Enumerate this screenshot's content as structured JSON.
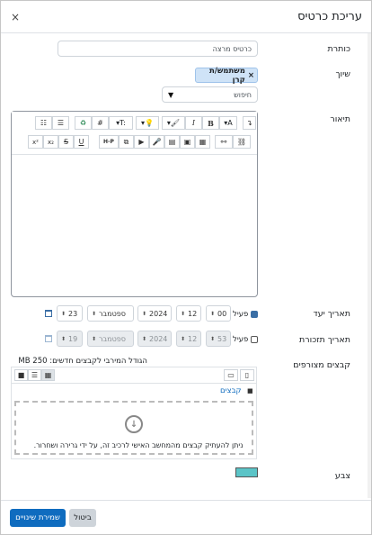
{
  "modal": {
    "title": "עריכת כרטיס",
    "close_glyph": "×"
  },
  "fields": {
    "title": {
      "label": "כותרת",
      "value": "כרטיס מרצה"
    },
    "assign": {
      "label": "שיוך",
      "pill": "משתמש/ת קרן",
      "pill_remove": "×",
      "search_placeholder": "חיפוש",
      "dropdown_arrow": "▼"
    },
    "description": {
      "label": "תיאור"
    },
    "due": {
      "label": "תאריך יעד",
      "enable_label": "פעיל",
      "day": "23",
      "month": "ספטמבר",
      "year": "2024",
      "hour": "12",
      "minute": "00"
    },
    "reminder": {
      "label": "תאריך תזכורת",
      "enable_label": "פעיל",
      "day": "19",
      "month": "ספטמבר",
      "year": "2024",
      "hour": "12",
      "minute": "53"
    },
    "files": {
      "label": "קבצים מצורפים",
      "max_size": "הגודל המירבי לקבצים חדשים: 250 MB",
      "folder_label": "קבצים",
      "drop_text": "ניתן להעתיק קבצים מהמחשב האישי לרכיב זה, על ידי גרירה ושחרור."
    },
    "color": {
      "label": "צבע",
      "value": "#5bc4c7"
    }
  },
  "toolbar": {
    "row1": [
      "↴",
      "#",
      "T:",
      "💡",
      "🖌",
      "I",
      "B",
      "A",
      "☰",
      "☷"
    ],
    "row2": [
      "x²",
      "x₂",
      "S",
      "U",
      "H-P",
      "⧉",
      "🎥",
      "🎤",
      "📄",
      "🖼",
      "🖻",
      "🔗",
      "⛓"
    ]
  },
  "footer": {
    "save": "שמירת שינויים",
    "cancel": "ביטול"
  }
}
